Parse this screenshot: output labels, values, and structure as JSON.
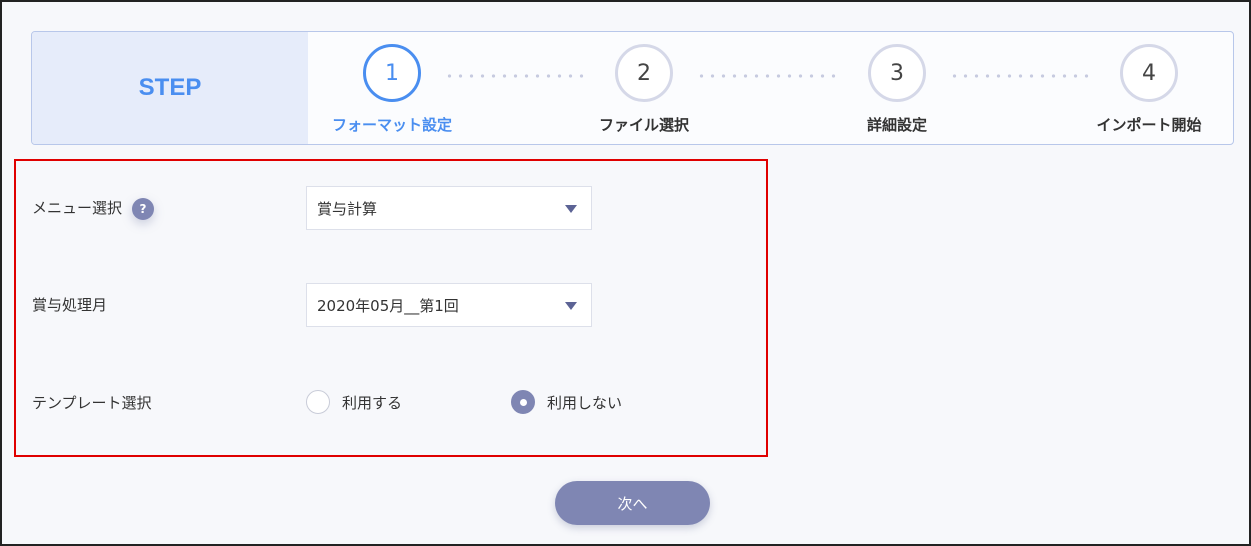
{
  "stepper": {
    "heading": "STEP",
    "steps": [
      {
        "number": "1",
        "label": "フォーマット設定"
      },
      {
        "number": "2",
        "label": "ファイル選択"
      },
      {
        "number": "3",
        "label": "詳細設定"
      },
      {
        "number": "4",
        "label": "インポート開始"
      }
    ]
  },
  "form": {
    "menu": {
      "label": "メニュー選択",
      "help": "?",
      "value": "賞与計算"
    },
    "month": {
      "label": "賞与処理月",
      "value": "2020年05月__第1回"
    },
    "template": {
      "label": "テンプレート選択",
      "options": [
        {
          "label": "利用する",
          "checked": false
        },
        {
          "label": "利用しない",
          "checked": true
        }
      ]
    }
  },
  "actions": {
    "next_label": "次へ"
  },
  "colors": {
    "accent": "#4a8ef0",
    "primary_button": "#7f86b3",
    "highlight_border": "#e00000"
  }
}
